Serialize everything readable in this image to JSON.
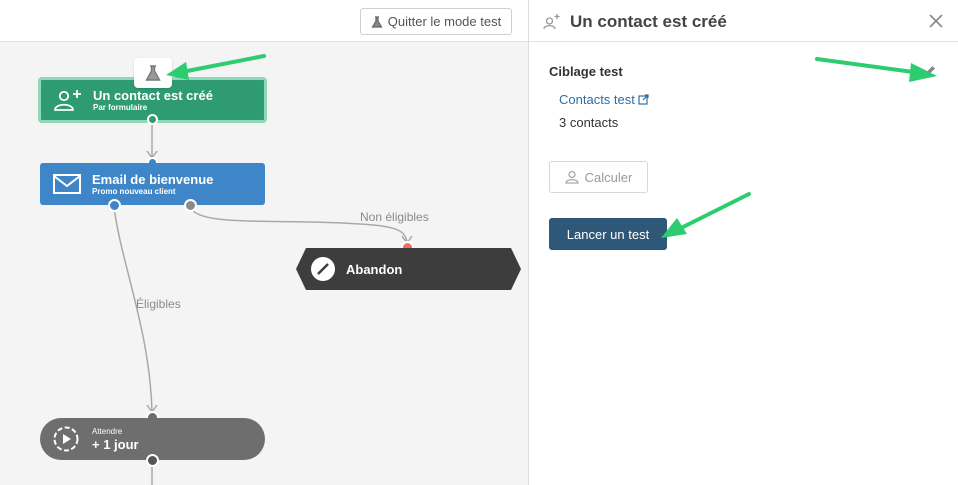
{
  "toolbar": {
    "quit_test_mode": "Quitter le mode test"
  },
  "workflow": {
    "trigger": {
      "title": "Un contact est créé",
      "subtitle": "Par formulaire"
    },
    "email": {
      "title": "Email de bienvenue",
      "subtitle": "Promo nouveau client"
    },
    "abandon": {
      "title": "Abandon"
    },
    "wait": {
      "subtitle": "Attendre",
      "title": "+ 1 jour"
    },
    "labels": {
      "not_eligible": "Non éligibles",
      "eligible": "Éligibles"
    }
  },
  "panel": {
    "title": "Un contact est créé",
    "section_title": "Ciblage test",
    "contacts_link": "Contacts test",
    "contacts_count": "3 contacts",
    "calculate_button": "Calculer",
    "launch_button": "Lancer un test"
  },
  "colors": {
    "trigger": "#2e9b73",
    "email": "#3f86c8",
    "abandon": "#3d3d3d",
    "wait": "#6e6e6e",
    "primary_button": "#2f5777",
    "annotation_arrow": "#2ecc71"
  }
}
